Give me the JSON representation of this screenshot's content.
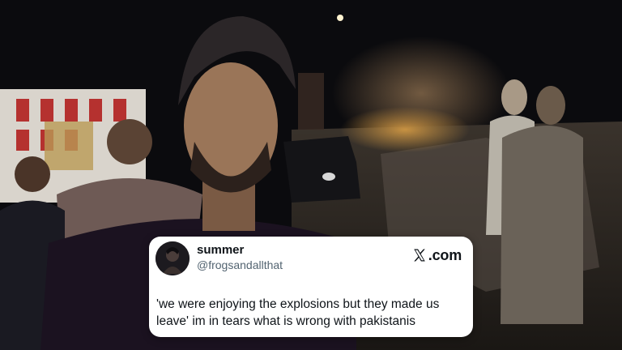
{
  "tweet": {
    "display_name": "summer",
    "handle": "@frogsandallthat",
    "brand": ".com",
    "text": "'we were enjoying the explosions but they made us leave' im in tears what is wrong with pakistanis"
  },
  "icons": {
    "brand_logo": "x-logo-icon",
    "avatar": "avatar"
  }
}
